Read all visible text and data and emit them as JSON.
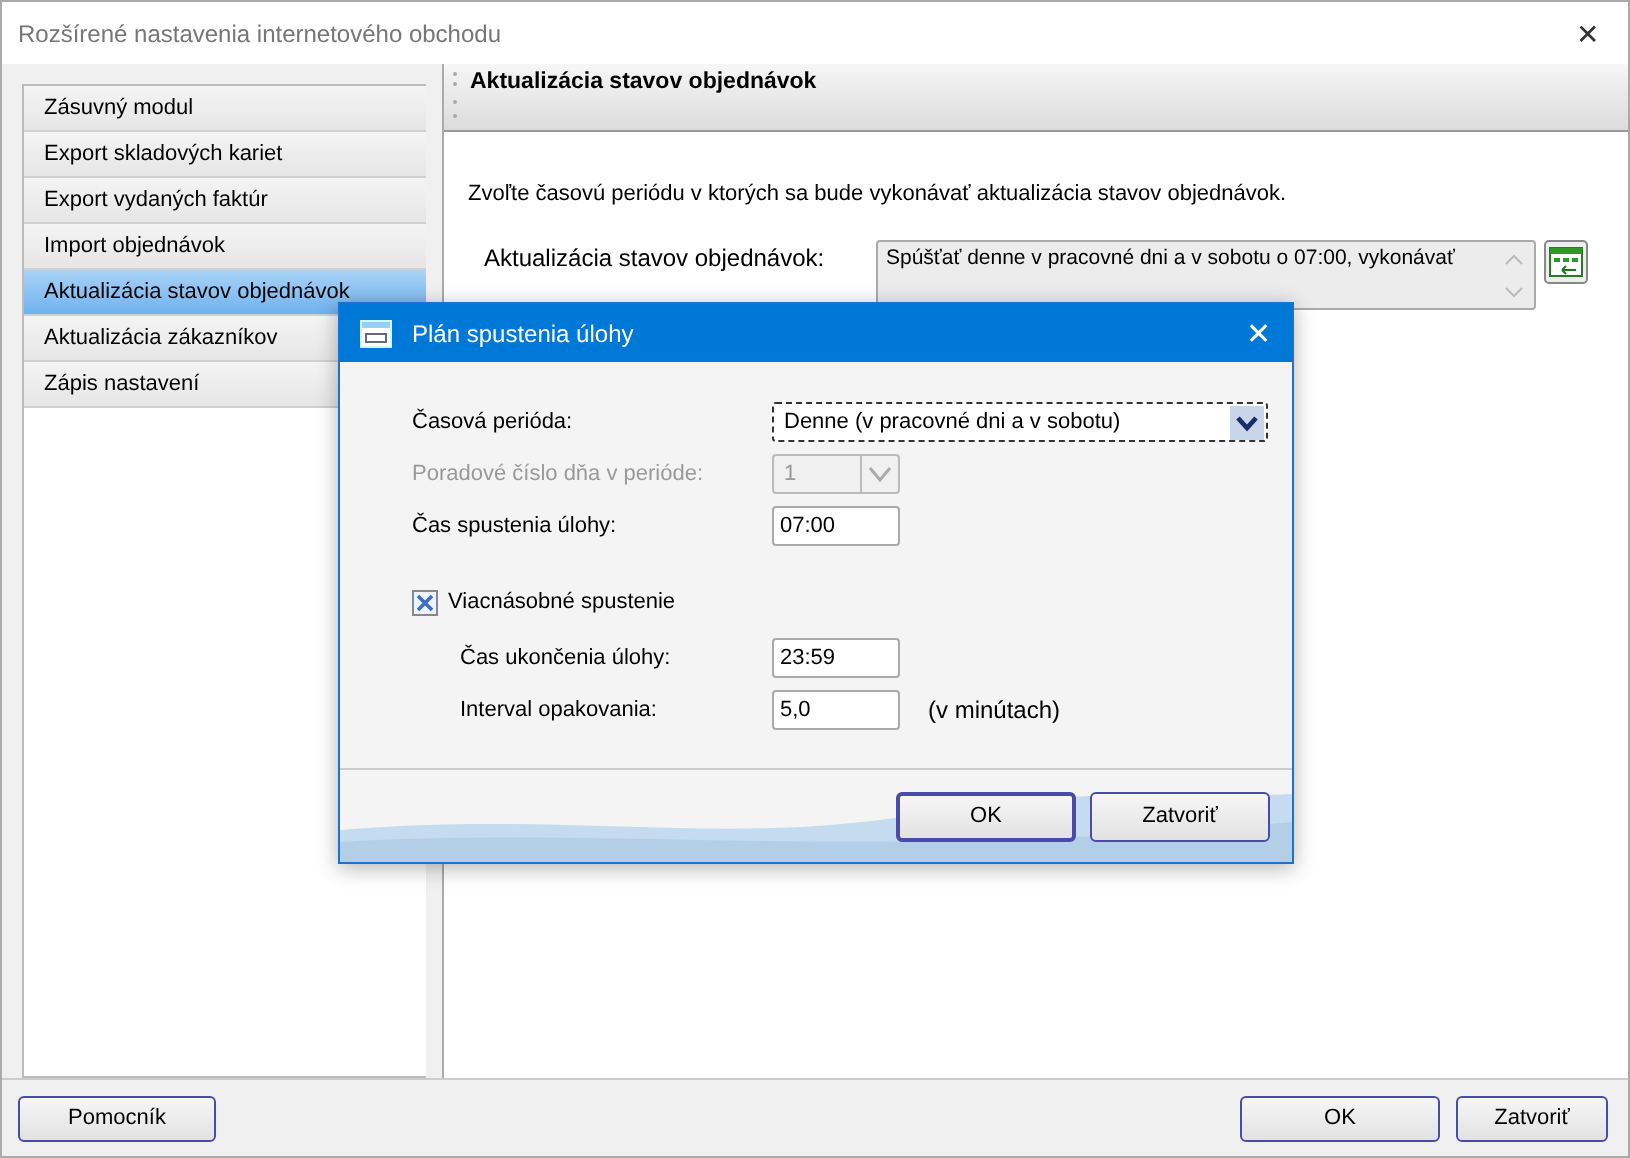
{
  "window": {
    "title": "Rozšírené nastavenia internetového obchodu",
    "close": "✕"
  },
  "sidebar": {
    "items": [
      {
        "label": "Zásuvný modul",
        "selected": false
      },
      {
        "label": "Export skladových kariet",
        "selected": false
      },
      {
        "label": "Export vydaných faktúr",
        "selected": false
      },
      {
        "label": "Import objednávok",
        "selected": false
      },
      {
        "label": "Aktualizácia stavov objednávok",
        "selected": true
      },
      {
        "label": "Aktualizácia zákazníkov",
        "selected": false
      },
      {
        "label": "Zápis nastavení",
        "selected": false
      }
    ]
  },
  "panel": {
    "title": "Aktualizácia stavov objednávok",
    "description": "Zvoľte časovú periódu v ktorých sa bude vykonávať aktualizácia stavov objednávok.",
    "field_label": "Aktualizácia stavov objednávok:",
    "field_value": "Spúšťať denne v pracovné dni a v sobotu o 07:00, vykonávať"
  },
  "footer": {
    "buttons": [
      {
        "label": "Pomocník",
        "kind": "left"
      },
      {
        "label": "OK",
        "kind": "right"
      },
      {
        "label": "Zatvoriť",
        "kind": "right"
      }
    ]
  },
  "dialog": {
    "title": "Plán spustenia úlohy",
    "close": "✕",
    "rows": [
      {
        "kind": "combo",
        "label": "Časová perióda:",
        "value": "Denne (v pracovné dni a v sobotu)",
        "disabled": false
      },
      {
        "kind": "combo_small",
        "label": "Poradové číslo dňa v perióde:",
        "value": "1",
        "disabled": true
      },
      {
        "kind": "input",
        "label": "Čas spustenia úlohy:",
        "value": "07:00",
        "disabled": false
      },
      {
        "kind": "checkbox",
        "label": "Viacnásobné spustenie",
        "checked": true,
        "children": [
          {
            "kind": "input",
            "label": "Čas ukončenia úlohy:",
            "value": "23:59",
            "disabled": false
          },
          {
            "kind": "input",
            "label": "Interval opakovania:",
            "value": "5,0",
            "disabled": false,
            "unit": "(v minútach)"
          }
        ]
      }
    ],
    "buttons": [
      "OK",
      "Zatvoriť"
    ]
  }
}
